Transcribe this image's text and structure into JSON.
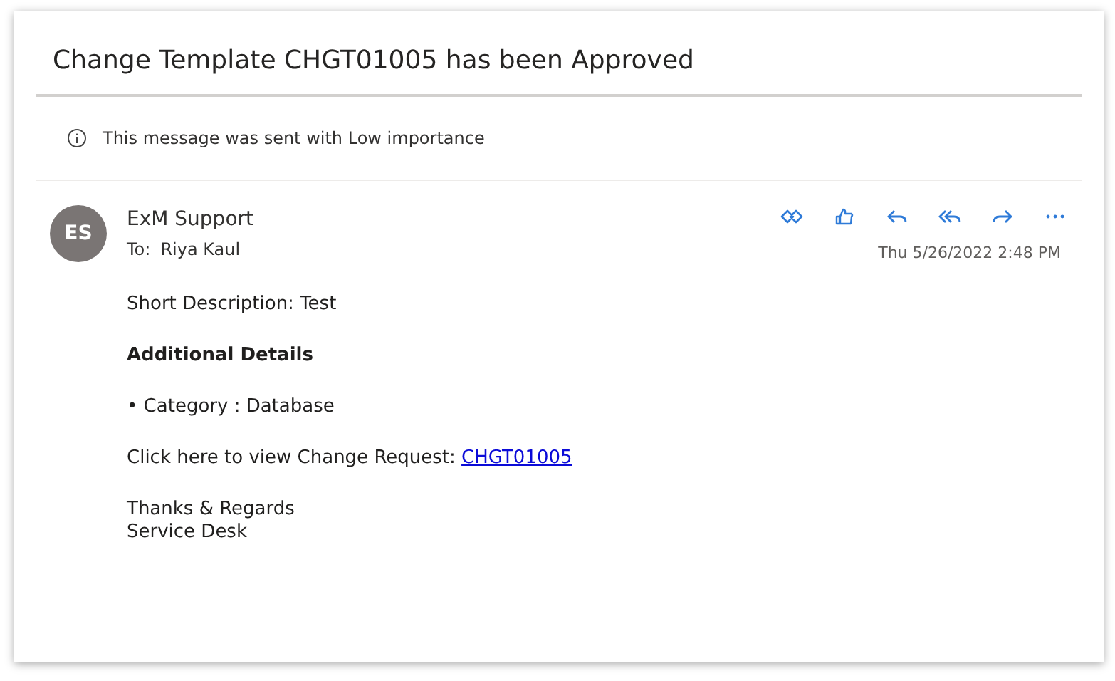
{
  "subject": "Change Template CHGT01005 has been Approved",
  "notice": "This message was sent with Low importance",
  "sender": {
    "initials": "ES",
    "name": "ExM Support",
    "to_label": "To:",
    "to": "Riya Kaul"
  },
  "date": "Thu 5/26/2022 2:48 PM",
  "body": [
    {
      "kind": "text",
      "text": "Short Description: Test"
    },
    {
      "kind": "heading",
      "text": "Additional Details"
    },
    {
      "kind": "text",
      "text": "• Category : Database"
    },
    {
      "kind": "link_line",
      "text": "Click here to view Change Request:",
      "link": "CHGT01005"
    },
    {
      "kind": "lines",
      "lines": [
        "Thanks & Regards",
        "Service Desk"
      ]
    }
  ]
}
